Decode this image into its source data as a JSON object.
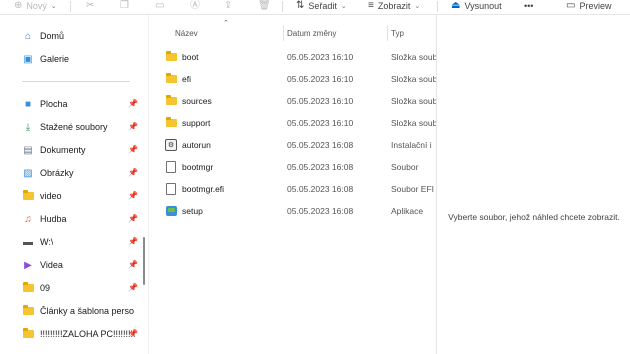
{
  "toolbar": {
    "new_label": "Nový",
    "sort_label": "Seřadit",
    "view_label": "Zobrazit",
    "eject_label": "Vysunout",
    "more_label": "•••",
    "preview_label": "Preview"
  },
  "sidebar": {
    "top": [
      {
        "label": "Domů",
        "icon": "home-icon"
      },
      {
        "label": "Galerie",
        "icon": "gallery-icon"
      }
    ],
    "quick": [
      {
        "label": "Plocha",
        "icon": "desktop-icon",
        "pinned": true
      },
      {
        "label": "Stažené soubory",
        "icon": "download-icon",
        "pinned": true
      },
      {
        "label": "Dokumenty",
        "icon": "documents-icon",
        "pinned": true
      },
      {
        "label": "Obrázky",
        "icon": "pictures-icon",
        "pinned": true
      },
      {
        "label": "video",
        "icon": "folder-icon",
        "pinned": true
      },
      {
        "label": "Hudba",
        "icon": "music-icon",
        "pinned": true
      },
      {
        "label": "W:\\",
        "icon": "drive-icon",
        "pinned": true
      },
      {
        "label": "Videa",
        "icon": "videos-icon",
        "pinned": true
      },
      {
        "label": "09",
        "icon": "folder-icon",
        "pinned": true
      },
      {
        "label": "Články a šablona perso",
        "icon": "folder-icon",
        "pinned": false
      },
      {
        "label": "!!!!!!!!!ZALOHA PC!!!!!!!!!",
        "icon": "folder-icon",
        "pinned": true
      }
    ]
  },
  "columns": {
    "name": "Název",
    "date": "Datum změny",
    "type": "Typ"
  },
  "files": [
    {
      "name": "boot",
      "date": "05.05.2023 16:10",
      "type": "Složka soubor",
      "icon": "folder-icon"
    },
    {
      "name": "efi",
      "date": "05.05.2023 16:10",
      "type": "Složka soubor",
      "icon": "folder-icon"
    },
    {
      "name": "sources",
      "date": "05.05.2023 16:10",
      "type": "Složka soubor",
      "icon": "folder-icon"
    },
    {
      "name": "support",
      "date": "05.05.2023 16:10",
      "type": "Složka soubor",
      "icon": "folder-icon"
    },
    {
      "name": "autorun",
      "date": "05.05.2023 16:08",
      "type": "Instalační i",
      "icon": "setup-info-icon"
    },
    {
      "name": "bootmgr",
      "date": "05.05.2023 16:08",
      "type": "Soubor",
      "icon": "file-icon"
    },
    {
      "name": "bootmgr.efi",
      "date": "05.05.2023 16:08",
      "type": "Soubor EFI",
      "icon": "file-icon"
    },
    {
      "name": "setup",
      "date": "05.05.2023 16:08",
      "type": "Aplikace",
      "icon": "application-icon"
    }
  ],
  "preview": {
    "message": "Vyberte soubor, jehož náhled chcete zobrazit."
  },
  "colors": {
    "folder": "#f4c431",
    "accent": "#0067c0"
  }
}
